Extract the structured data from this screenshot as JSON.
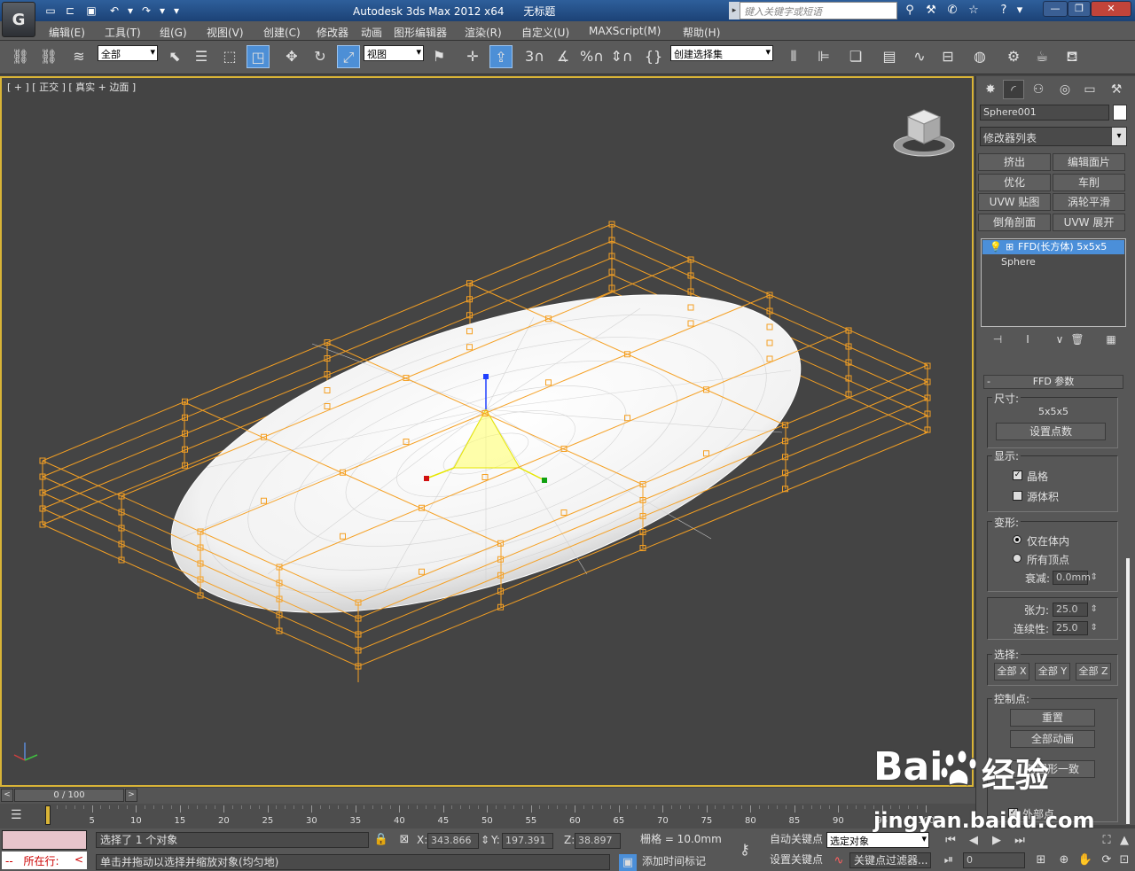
{
  "title_bar": {
    "title": "Autodesk 3ds Max  2012 x64",
    "doc_name": "无标题",
    "search_placeholder": "键入关键字或短语",
    "app_logo": "G"
  },
  "menu": [
    "编辑(E)",
    "工具(T)",
    "组(G)",
    "视图(V)",
    "创建(C)",
    "修改器",
    "动画",
    "图形编辑器",
    "渲染(R)",
    "自定义(U)",
    "MAXScript(M)",
    "帮助(H)"
  ],
  "toolbar": {
    "selection_filter": "全部",
    "reference_coord": "视图",
    "named_selection": "创建选择集",
    "snap_label": "3",
    "percent_label": "%"
  },
  "viewport": {
    "label": "[ + ] [ 正交 ] [ 真实 + 边面 ]",
    "accent": "#d9b437",
    "lattice_color": "#f5a023"
  },
  "command_panel": {
    "object_name": "Sphere001",
    "modifier_list": "修改器列表",
    "modifier_buttons": [
      "挤出",
      "编辑面片",
      "优化",
      "车削",
      "UVW 贴图",
      "涡轮平滑",
      "倒角剖面",
      "UVW 展开"
    ],
    "stack": {
      "selected": "FFD(长方体) 5x5x5",
      "base": "Sphere"
    },
    "ffd": {
      "title": "FFD 参数",
      "size_label": "尺寸:",
      "size_value": "5x5x5",
      "set_points": "设置点数",
      "display_label": "显示:",
      "lattice": "晶格",
      "source_volume": "源体积",
      "deform_label": "变形:",
      "only_in_volume": "仅在体内",
      "all_vertices": "所有顶点",
      "falloff_label": "衰减:",
      "falloff_value": "0.0mm",
      "tension_label": "张力:",
      "tension_value": "25.0",
      "continuity_label": "连续性:",
      "continuity_value": "25.0",
      "selection_label": "选择:",
      "all_x": "全部 X",
      "all_y": "全部 Y",
      "all_z": "全部 Z",
      "control_points_label": "控制点:",
      "reset": "重置",
      "animate_all": "全部动画",
      "conform": "与图形一致",
      "outer_points": "外部点"
    }
  },
  "timeline": {
    "frame_display": "0 / 100",
    "ticks": [
      "0",
      "5",
      "10",
      "15",
      "20",
      "25",
      "30",
      "35",
      "40",
      "45",
      "50",
      "55",
      "60",
      "65",
      "70",
      "75",
      "80",
      "85",
      "90",
      "95",
      "100"
    ]
  },
  "status": {
    "selected": "选择了 1 个对象",
    "prompt": "单击并拖动以选择并缩放对象(均匀地)",
    "running": "所在行:",
    "x_label": "X:",
    "x_value": "343.866",
    "y_label": "Y:",
    "y_value": "197.391",
    "z_label": "Z:",
    "z_value": "38.897",
    "grid": "栅格 = 10.0mm",
    "add_time_tag": "添加时间标记",
    "auto_key": "自动关键点",
    "set_key": "设置关键点",
    "selected_object": "选定对象",
    "key_filters": "关键点过滤器...",
    "frame": "0"
  },
  "watermark": {
    "brand": "Bai",
    "brand2": "经验",
    "url": "jingyan.baidu.com"
  }
}
